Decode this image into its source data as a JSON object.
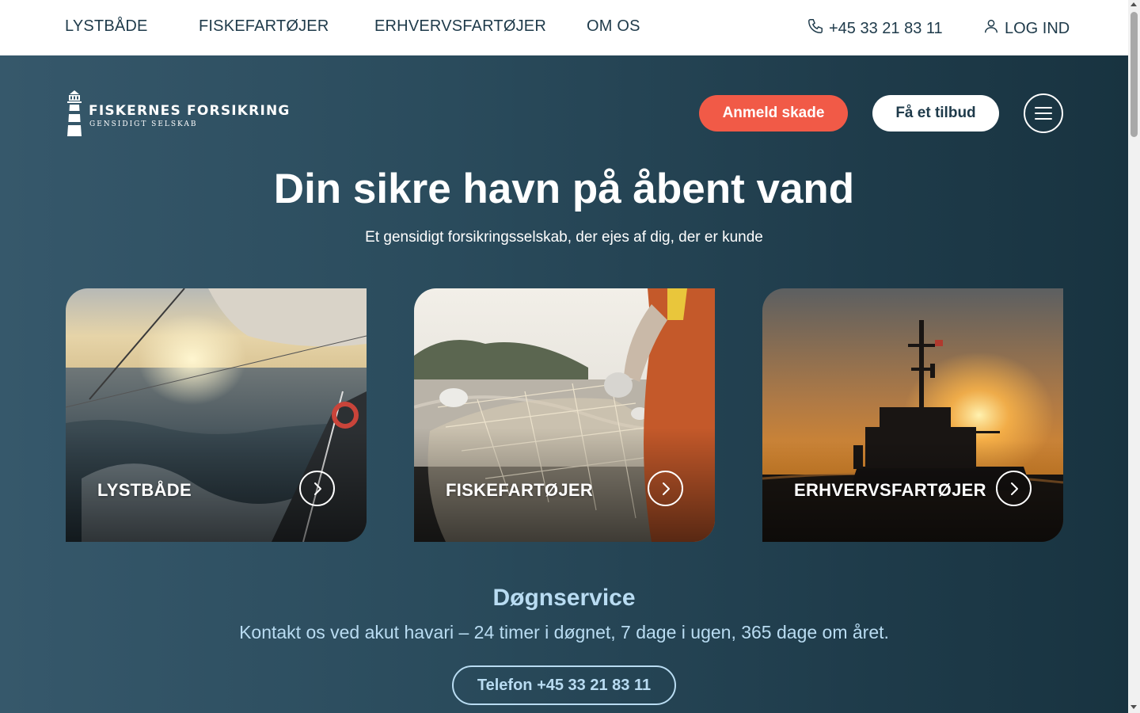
{
  "topnav": {
    "items": [
      {
        "label": "LYSTBÅDE"
      },
      {
        "label": "FISKEFARTØJER"
      },
      {
        "label": "ERHVERVSFARTØJER"
      },
      {
        "label": "OM OS"
      }
    ],
    "phone": "+45 33 21 83 11",
    "phone_icon": "phone-icon",
    "login": "LOG IND",
    "login_icon": "user-icon"
  },
  "header": {
    "logo_name": "FISKERNES FORSIKRING",
    "logo_sub": "GENSIDIGT SELSKAB",
    "report_button": "Anmeld skade",
    "offer_button": "Få et tilbud",
    "menu_icon": "hamburger-menu-icon"
  },
  "hero": {
    "title": "Din sikre havn på åbent vand",
    "subtitle": "Et gensidigt forsikringsselskab, der ejes af dig, der er kunde"
  },
  "cards": [
    {
      "label": "LYSTBÅDE",
      "icon": "chevron-right-icon"
    },
    {
      "label": "FISKEFARTØJER",
      "icon": "chevron-right-icon"
    },
    {
      "label": "ERHVERVSFARTØJER",
      "icon": "chevron-right-icon"
    }
  ],
  "service": {
    "title": "Døgnservice",
    "text": "Kontakt os ved akut havari – 24 timer i døgnet, 7 dage i ugen, 365 dage om året.",
    "phone_button": "Telefon +45 33 21 83 11"
  },
  "colors": {
    "accent": "#f15a47",
    "hero_dark": "#1f3c4b",
    "service_text": "#b9dcf2",
    "nav_text": "#1e3a4a"
  }
}
